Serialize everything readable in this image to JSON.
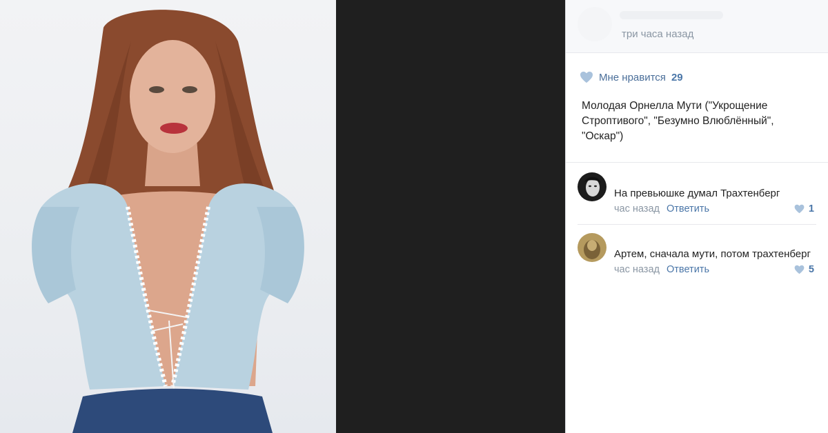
{
  "post": {
    "time": "три часа назад",
    "likes_label": "Мне нравится",
    "likes_count": "29",
    "text": "Молодая Орнелла Мути (\"Укрощение Строптивого\", \"Безумно Влюблённый\", \"Оскар\")"
  },
  "comments": [
    {
      "text": "На превьюшке думал Трахтенберг",
      "time": "час назад",
      "reply_label": "Ответить",
      "likes": "1"
    },
    {
      "text": "Артем, сначала мути, потом трахтенберг",
      "time": "час назад",
      "reply_label": "Ответить",
      "likes": "5"
    }
  ],
  "icons": {
    "like": "heart-icon"
  },
  "colors": {
    "accent": "#4a76a8",
    "muted": "#8a96a3",
    "heart": "#a9c2dc",
    "photo_backdrop": "#1f1f1f"
  }
}
